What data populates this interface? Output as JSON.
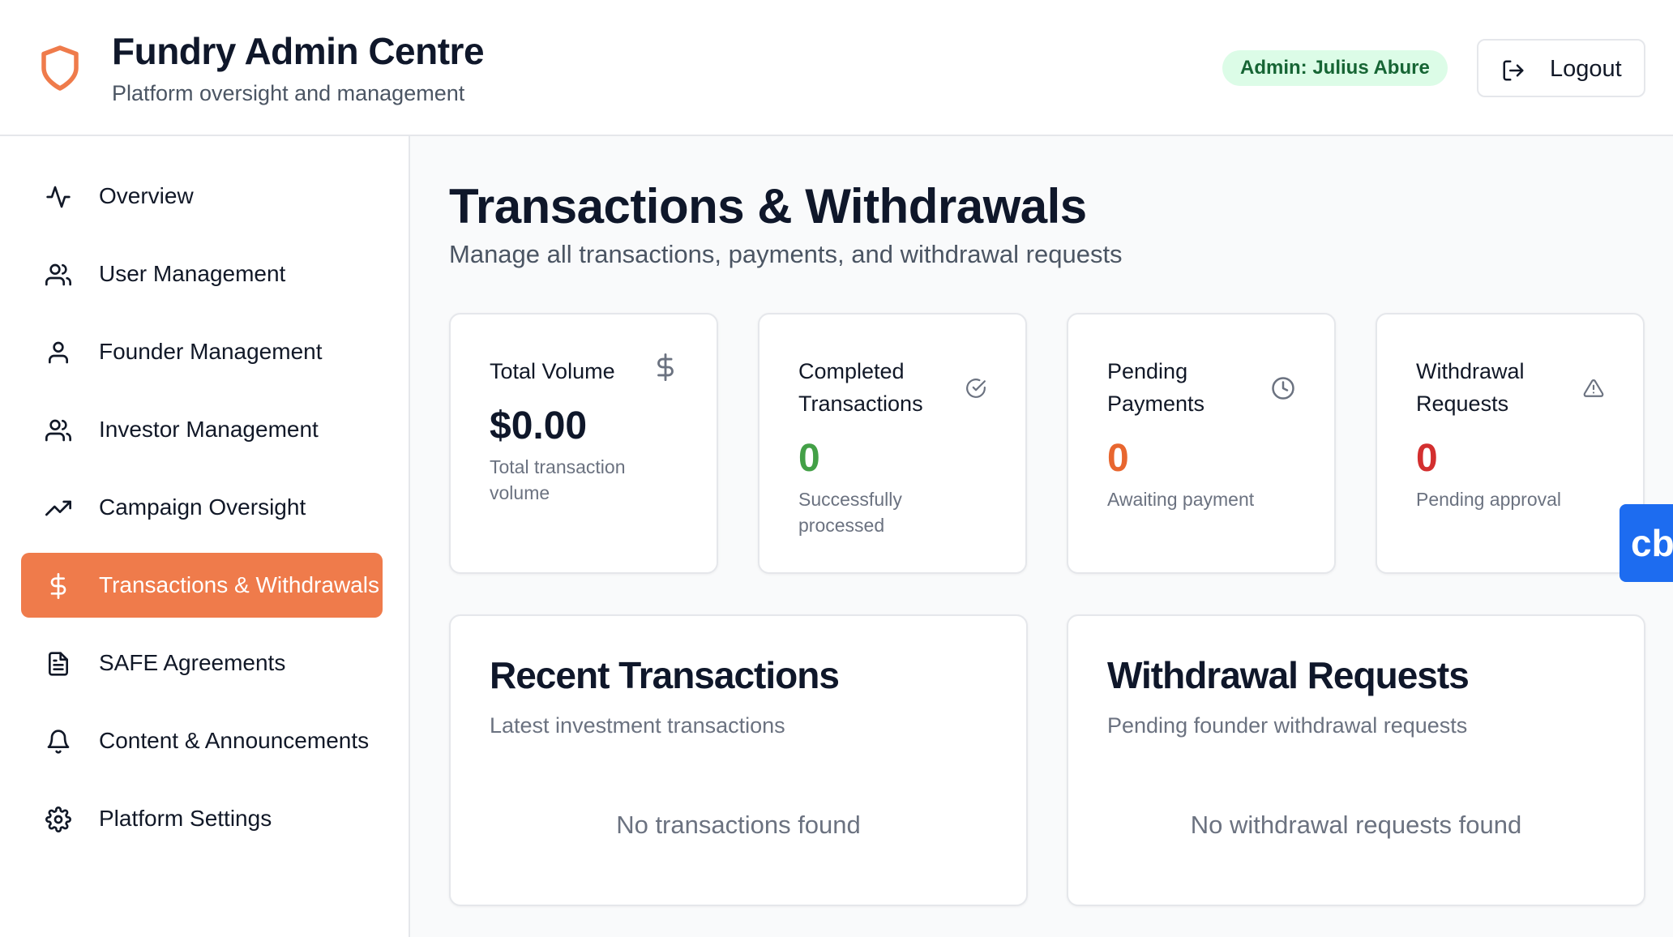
{
  "header": {
    "title": "Fundry Admin Centre",
    "subtitle": "Platform oversight and management",
    "admin_badge": "Admin: Julius Abure",
    "logout_label": "Logout"
  },
  "sidebar": {
    "items": [
      {
        "label": "Overview",
        "icon": "activity-icon",
        "active": false
      },
      {
        "label": "User Management",
        "icon": "users-icon",
        "active": false
      },
      {
        "label": "Founder Management",
        "icon": "user-icon",
        "active": false
      },
      {
        "label": "Investor Management",
        "icon": "users-icon",
        "active": false
      },
      {
        "label": "Campaign Oversight",
        "icon": "trending-up-icon",
        "active": false
      },
      {
        "label": "Transactions & Withdrawals",
        "icon": "dollar-icon",
        "active": true
      },
      {
        "label": "SAFE Agreements",
        "icon": "file-text-icon",
        "active": false
      },
      {
        "label": "Content & Announcements",
        "icon": "bell-icon",
        "active": false
      },
      {
        "label": "Platform Settings",
        "icon": "settings-icon",
        "active": false
      }
    ]
  },
  "main": {
    "title": "Transactions & Withdrawals",
    "subtitle": "Manage all transactions, payments, and withdrawal requests",
    "stats": [
      {
        "title": "Total Volume",
        "value": "$0.00",
        "desc": "Total transaction volume",
        "icon": "dollar-icon",
        "color": "#0f172a"
      },
      {
        "title": "Completed Transactions",
        "value": "0",
        "desc": "Successfully processed",
        "icon": "check-circle-icon",
        "color": "#43a047"
      },
      {
        "title": "Pending Payments",
        "value": "0",
        "desc": "Awaiting payment",
        "icon": "clock-icon",
        "color": "#e8662f"
      },
      {
        "title": "Withdrawal Requests",
        "value": "0",
        "desc": "Pending approval",
        "icon": "alert-triangle-icon",
        "color": "#d32f2f"
      }
    ],
    "recent": {
      "title": "Recent Transactions",
      "subtitle": "Latest investment transactions",
      "empty": "No transactions found"
    },
    "withdrawals": {
      "title": "Withdrawal Requests",
      "subtitle": "Pending founder withdrawal requests",
      "empty": "No withdrawal requests found"
    }
  },
  "floating_widget": {
    "label": "cb"
  },
  "colors": {
    "accent": "#ef7b4b",
    "badge_bg": "#dcfce7",
    "badge_text": "#166534",
    "widget": "#1d6cf0"
  }
}
